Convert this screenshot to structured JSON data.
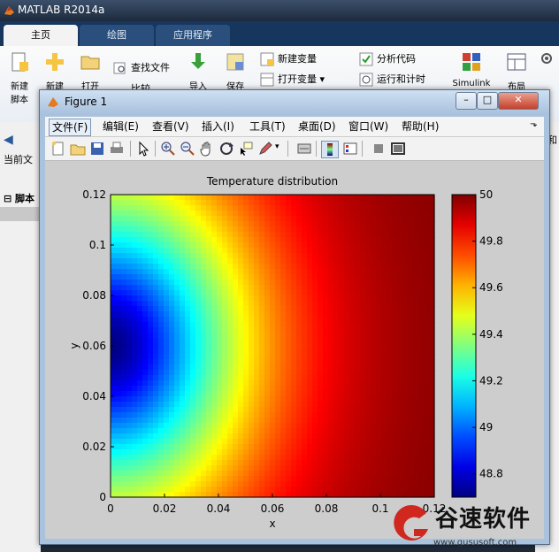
{
  "matlab": {
    "title": "MATLAB R2014a",
    "tabs": [
      "主页",
      "绘图",
      "应用程序"
    ],
    "ribbon": {
      "new_script": "新建\n脚本",
      "new": "新建",
      "open": "打开",
      "find_files": "查找文件",
      "compare": "比较",
      "import": "导入",
      "save": "保存",
      "new_variable": "新建变量",
      "open_variable": "打开变量",
      "analyze_code": "分析代码",
      "run_and_time": "运行和计时",
      "simulink": "Simulink",
      "layout": "布局"
    },
    "left_panel": {
      "current_folder": "当前文",
      "script_label": "脚本"
    },
    "right_strip_label": "和"
  },
  "figure": {
    "title": "Figure 1",
    "menus": [
      "文件(F)",
      "编辑(E)",
      "查看(V)",
      "插入(I)",
      "工具(T)",
      "桌面(D)",
      "窗口(W)",
      "帮助(H)"
    ],
    "toolbar_icons": [
      "new-figure-icon",
      "open-file-icon",
      "save-icon",
      "print-icon",
      "pointer-icon",
      "zoom-in-icon",
      "zoom-out-icon",
      "pan-hand-icon",
      "rotate-icon",
      "data-cursor-icon",
      "brush-icon",
      "link-icon",
      "colorbar-toggle-icon",
      "legend-toggle-icon",
      "hide-plot-tools-icon",
      "show-plot-tools-icon"
    ]
  },
  "chart_data": {
    "type": "heatmap",
    "title": "Temperature distribution",
    "xlabel": "x",
    "ylabel": "y",
    "xlim": [
      0,
      0.12
    ],
    "ylim": [
      0,
      0.12
    ],
    "x_ticks": [
      "0",
      "0.02",
      "0.04",
      "0.06",
      "0.08",
      "0.1",
      "0.12"
    ],
    "y_ticks": [
      "0",
      "0.02",
      "0.04",
      "0.06",
      "0.08",
      "0.1",
      "0.12"
    ],
    "colormap": "jet",
    "clim": [
      48.7,
      50
    ],
    "colorbar_ticks": [
      "48.8",
      "49",
      "49.2",
      "49.4",
      "49.6",
      "49.8",
      "50"
    ],
    "colorbar_values": [
      48.8,
      49,
      49.2,
      49.4,
      49.6,
      49.8,
      50
    ],
    "min_value": 48.7,
    "max_value": 50,
    "min_location": [
      0,
      0.06
    ],
    "description_values": "coldest (~48.7) at left edge near y=0.06, rising to 50 at right and top"
  },
  "watermark": {
    "text": "谷速软件",
    "url": "www.gususoft.com"
  }
}
